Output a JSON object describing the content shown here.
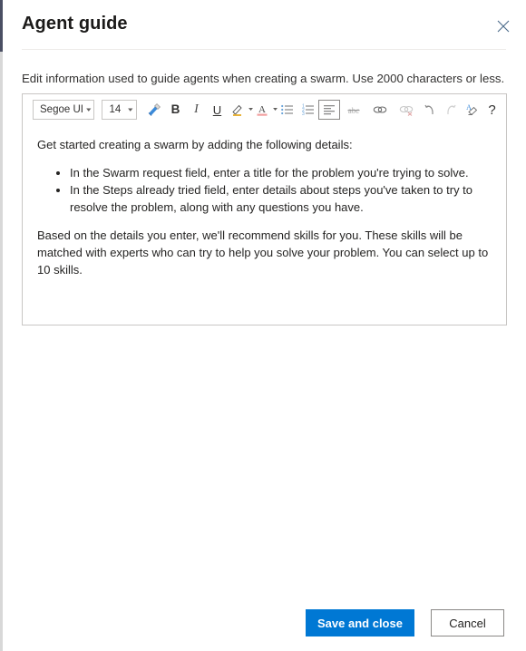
{
  "panel": {
    "title": "Agent guide",
    "close_icon": "close-icon",
    "description": "Edit information used to guide agents when creating a swarm. Use 2000 characters or less."
  },
  "editor": {
    "toolbar": {
      "font_family": {
        "value": "Segoe UI",
        "caret": "▾"
      },
      "font_size": {
        "value": "14",
        "caret": "▾"
      },
      "buttons": [
        {
          "name": "format-painter-icon",
          "label": "Format painter",
          "glyph": ""
        },
        {
          "name": "bold-icon",
          "label": "Bold",
          "glyph": "B"
        },
        {
          "name": "italic-icon",
          "label": "Italic",
          "glyph": "I"
        },
        {
          "name": "underline-icon",
          "label": "Underline",
          "glyph": "U"
        },
        {
          "name": "highlight-color-icon",
          "label": "Highlight color",
          "glyph": ""
        },
        {
          "name": "font-color-icon",
          "label": "Font color",
          "glyph": "A"
        },
        {
          "name": "bulleted-list-icon",
          "label": "Bulleted list",
          "glyph": ""
        },
        {
          "name": "numbered-list-icon",
          "label": "Numbered list",
          "glyph": ""
        },
        {
          "name": "align-left-icon",
          "label": "Align left",
          "glyph": ""
        },
        {
          "name": "strikethrough-icon",
          "label": "Strikethrough",
          "glyph": ""
        },
        {
          "name": "insert-link-icon",
          "label": "Insert link",
          "glyph": ""
        },
        {
          "name": "remove-link-icon",
          "label": "Remove link",
          "glyph": ""
        },
        {
          "name": "undo-icon",
          "label": "Undo",
          "glyph": ""
        },
        {
          "name": "redo-icon",
          "label": "Redo",
          "glyph": ""
        },
        {
          "name": "clear-formatting-icon",
          "label": "Clear formatting",
          "glyph": ""
        },
        {
          "name": "help-icon",
          "label": "Help",
          "glyph": "?"
        }
      ]
    },
    "content": {
      "intro": "Get started creating a swarm by adding the following details:",
      "bullets": [
        "In the Swarm request field, enter a title for the problem you're trying to solve.",
        "In the Steps already tried field, enter details about steps you've taken to try to resolve the problem, along with any questions you have."
      ],
      "outro": "Based on the details you enter, we'll recommend skills for you. These skills will be matched with experts who can try to help you solve your problem. You can select up to 10 skills."
    }
  },
  "footer": {
    "save_label": "Save and close",
    "cancel_label": "Cancel"
  },
  "colors": {
    "accent_blue": "#0078d4",
    "edge_accent": "#4a4f63",
    "border": "#c8c6c4",
    "rule": "#edebe9"
  }
}
